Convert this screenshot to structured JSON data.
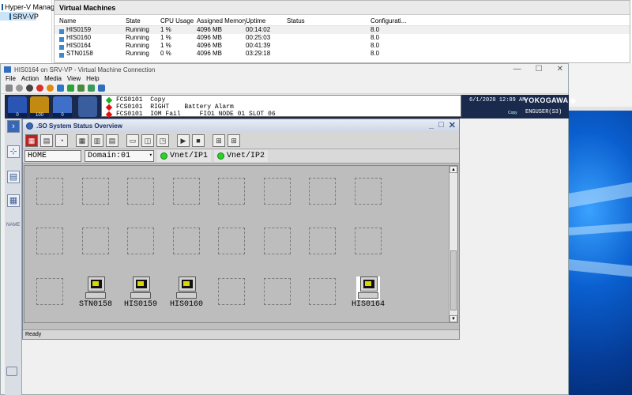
{
  "hyperv": {
    "tree": [
      "Hyper-V Manager",
      "SRV-VP"
    ],
    "panel_title": "Virtual Machines",
    "columns": [
      "Name",
      "State",
      "CPU Usage",
      "Assigned Memory",
      "Uptime",
      "Status",
      "Configurati..."
    ],
    "rows": [
      [
        "HIS0159",
        "Running",
        "1 %",
        "4096 MB",
        "00:14:02",
        "",
        "8.0"
      ],
      [
        "HIS0160",
        "Running",
        "1 %",
        "4096 MB",
        "00:25:03",
        "",
        "8.0"
      ],
      [
        "HIS0164",
        "Running",
        "1 %",
        "4096 MB",
        "00:41:39",
        "",
        "8.0"
      ],
      [
        "STN0158",
        "Running",
        "0 %",
        "4096 MB",
        "03:29:18",
        "",
        "8.0"
      ]
    ]
  },
  "vmconnect": {
    "title": "HIS0164 on SRV-VP - Virtual Machine Connection",
    "menu": [
      "File",
      "Action",
      "Media",
      "View",
      "Help"
    ],
    "controls": [
      "—",
      "☐",
      "✕"
    ]
  },
  "centum": {
    "alarm_counts": [
      "0",
      "100",
      "0"
    ],
    "alarms": [
      {
        "color": "#19b21e",
        "text": "FCS0101  Copy"
      },
      {
        "color": "#e01010",
        "text": "FCS0101  RIGHT    Battery Alarm"
      },
      {
        "color": "#e01010",
        "text": "FCS0101  IOM Fail     FIO1 NODE 01 SLOT 06"
      }
    ],
    "datetime": "6/1/2020 12:09 AM",
    "brand": "YOKOGAWA ◆",
    "copy": "Copy",
    "user": "ENGUSER(S3)",
    "side_label": "NAME"
  },
  "sso": {
    "title": ".SO System Status Overview",
    "home": "HOME",
    "domain": "Domain:01",
    "vnet1": "Vnet/IP1",
    "vnet2": "Vnet/IP2",
    "status": "Ready",
    "stations": [
      "STN0158",
      "HIS0159",
      "HIS0160",
      "HIS0164"
    ]
  }
}
